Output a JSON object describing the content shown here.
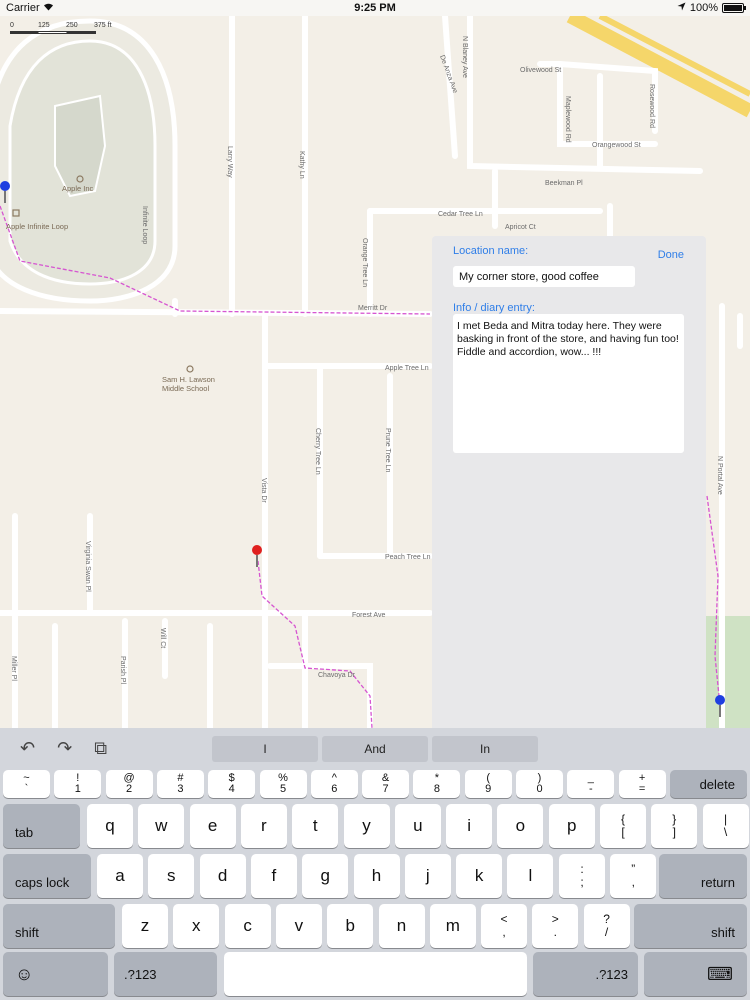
{
  "status": {
    "carrier": "Carrier",
    "time": "9:25 PM",
    "battery": "100%",
    "battery_level": 1.0
  },
  "map": {
    "scale_labels": [
      "0",
      "125",
      "250",
      "375 ft"
    ],
    "streets": {
      "blaney": "N Blaney Ave",
      "olivewood": "Olivewood St",
      "maplewood": "Maplewood Rd",
      "rosewood": "Rosewood Rd",
      "orangewood": "Orangewood St",
      "beekman": "Beekman Pl",
      "cedar": "Cedar Tree Ln",
      "apricot": "Apricot Ct",
      "orange": "Orange Tree Ln",
      "merritt": "Merritt Dr",
      "appletree": "Apple Tree Ln",
      "cherry": "Cherry Tree Ln",
      "prune": "Prune Tree Ln",
      "peach": "Peach Tree Ln",
      "forest": "Forest Ave",
      "chavoya": "Chavoya Dr",
      "portal": "N Portal Ave",
      "vista": "Vista Dr",
      "virginiaswan": "Virginia Swan Pl",
      "willct": "Will Ct",
      "parish": "Parish Pl",
      "miller": "Miller Pl",
      "infinite": "Infinite Loop",
      "larry": "Larry Way",
      "stevens": "Stevens Creek",
      "dealtaana": "De Anza Ave",
      "kathy": "Kathy Ln"
    },
    "pois": {
      "apple_inc": "Apple Inc",
      "apple_loop": "Apple Infinite Loop",
      "school_line1": "Sam H. Lawson",
      "school_line2": "Middle School"
    }
  },
  "editor": {
    "location_label": "Location name:",
    "done_label": "Done",
    "location_value": "My corner store, good coffee",
    "diary_label": "Info / diary entry:",
    "diary_value": "I met Beda and Mitra today here. They were basking in front of the store, and having fun too! Fiddle and accordion, wow... !!!"
  },
  "keyboard": {
    "tools": {
      "undo": "↶",
      "redo": "↷",
      "paste": "⧉"
    },
    "suggestions": [
      "I",
      "And",
      "In"
    ],
    "row_numbers": [
      [
        "~",
        "`"
      ],
      [
        "!",
        "1"
      ],
      [
        "@",
        "2"
      ],
      [
        "#",
        "3"
      ],
      [
        "$",
        "4"
      ],
      [
        "%",
        "5"
      ],
      [
        "^",
        "6"
      ],
      [
        "&",
        "7"
      ],
      [
        "*",
        "8"
      ],
      [
        "(",
        "9"
      ],
      [
        ")",
        "0"
      ],
      [
        "_",
        "-"
      ],
      [
        "+",
        "="
      ]
    ],
    "delete": "delete",
    "tab": "tab",
    "row_q": [
      "q",
      "w",
      "e",
      "r",
      "t",
      "y",
      "u",
      "i",
      "o",
      "p"
    ],
    "row_q_extra": [
      [
        "{",
        "["
      ],
      [
        "}",
        "]"
      ],
      [
        "|",
        "\\"
      ]
    ],
    "caps": "caps lock",
    "row_a": [
      "a",
      "s",
      "d",
      "f",
      "g",
      "h",
      "j",
      "k",
      "l"
    ],
    "row_a_extra": [
      [
        ":",
        ";"
      ],
      [
        "”",
        ","
      ]
    ],
    "return": "return",
    "shift": "shift",
    "row_z": [
      "z",
      "x",
      "c",
      "v",
      "b",
      "n",
      "m"
    ],
    "row_z_extra": [
      [
        "<",
        ","
      ],
      [
        ">",
        "."
      ],
      [
        "?",
        "/"
      ]
    ],
    "emoji": "☺",
    "numbers": ".?123",
    "hide": "⌨"
  }
}
